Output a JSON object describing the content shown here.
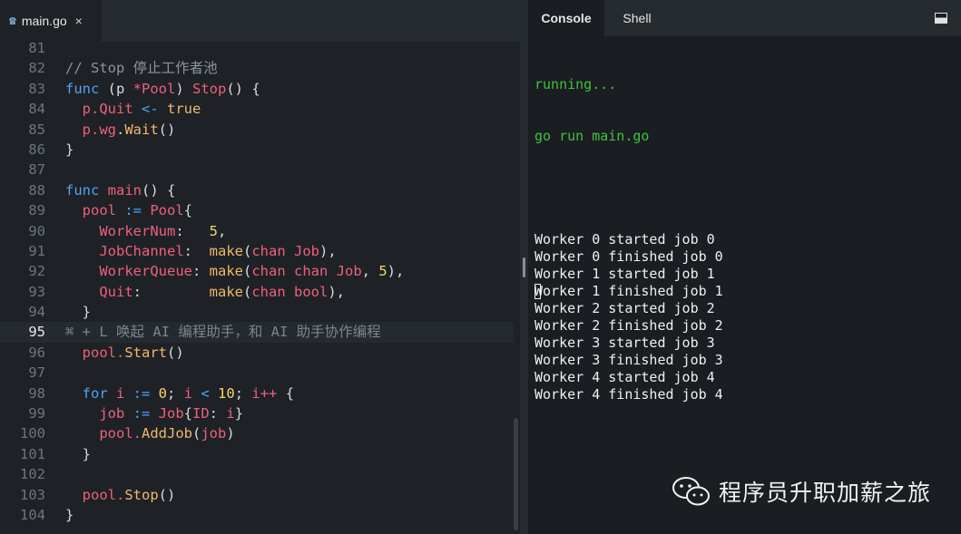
{
  "editor": {
    "tab": {
      "label": "main.go",
      "close": "×",
      "icon": "go-file-icon"
    },
    "current_line": 95,
    "lines": [
      {
        "n": "81",
        "tokens": []
      },
      {
        "n": "82",
        "tokens": [
          {
            "t": "// Stop 停止工作者池",
            "c": "cm"
          }
        ]
      },
      {
        "n": "83",
        "tokens": [
          {
            "t": "func",
            "c": "kw"
          },
          {
            "t": " (",
            "c": "pl"
          },
          {
            "t": "p",
            "c": "pl"
          },
          {
            "t": " *",
            "c": "op"
          },
          {
            "t": "Pool",
            "c": "ty"
          },
          {
            "t": ") ",
            "c": "pl"
          },
          {
            "t": "Stop",
            "c": "ty"
          },
          {
            "t": "() {",
            "c": "pl"
          }
        ]
      },
      {
        "n": "84",
        "tokens": [
          {
            "t": "  p.",
            "c": "op"
          },
          {
            "t": "Quit",
            "c": "ty"
          },
          {
            "t": " <- ",
            "c": "kw"
          },
          {
            "t": "true",
            "c": "bl"
          }
        ]
      },
      {
        "n": "85",
        "tokens": [
          {
            "t": "  p.",
            "c": "op"
          },
          {
            "t": "wg",
            "c": "ty"
          },
          {
            "t": ".",
            "c": "pl"
          },
          {
            "t": "Wait",
            "c": "fn"
          },
          {
            "t": "()",
            "c": "pl"
          }
        ]
      },
      {
        "n": "86",
        "tokens": [
          {
            "t": "}",
            "c": "pl"
          }
        ]
      },
      {
        "n": "87",
        "tokens": []
      },
      {
        "n": "88",
        "tokens": [
          {
            "t": "func",
            "c": "kw"
          },
          {
            "t": " main",
            "c": "ty"
          },
          {
            "t": "() {",
            "c": "pl"
          }
        ]
      },
      {
        "n": "89",
        "tokens": [
          {
            "t": "  pool",
            "c": "op"
          },
          {
            "t": " := ",
            "c": "kw"
          },
          {
            "t": "Pool",
            "c": "ty"
          },
          {
            "t": "{",
            "c": "pl"
          }
        ]
      },
      {
        "n": "90",
        "tokens": [
          {
            "t": "    WorkerNum",
            "c": "op"
          },
          {
            "t": ":   ",
            "c": "pl"
          },
          {
            "t": "5",
            "c": "nm"
          },
          {
            "t": ",",
            "c": "pl"
          }
        ]
      },
      {
        "n": "91",
        "tokens": [
          {
            "t": "    JobChannel",
            "c": "op"
          },
          {
            "t": ":  ",
            "c": "pl"
          },
          {
            "t": "make",
            "c": "fn"
          },
          {
            "t": "(",
            "c": "pl"
          },
          {
            "t": "chan",
            "c": "ty"
          },
          {
            "t": " Job",
            "c": "ty"
          },
          {
            "t": "),",
            "c": "pl"
          }
        ]
      },
      {
        "n": "92",
        "tokens": [
          {
            "t": "    WorkerQueue",
            "c": "op"
          },
          {
            "t": ": ",
            "c": "pl"
          },
          {
            "t": "make",
            "c": "fn"
          },
          {
            "t": "(",
            "c": "pl"
          },
          {
            "t": "chan chan",
            "c": "ty"
          },
          {
            "t": " Job",
            "c": "ty"
          },
          {
            "t": ", ",
            "c": "pl"
          },
          {
            "t": "5",
            "c": "nm"
          },
          {
            "t": "),",
            "c": "pl"
          }
        ]
      },
      {
        "n": "93",
        "tokens": [
          {
            "t": "    Quit",
            "c": "op"
          },
          {
            "t": ":        ",
            "c": "pl"
          },
          {
            "t": "make",
            "c": "fn"
          },
          {
            "t": "(",
            "c": "pl"
          },
          {
            "t": "chan",
            "c": "ty"
          },
          {
            "t": " bool",
            "c": "ty"
          },
          {
            "t": "),",
            "c": "pl"
          }
        ]
      },
      {
        "n": "94",
        "tokens": [
          {
            "t": "  }",
            "c": "pl"
          }
        ]
      },
      {
        "n": "95",
        "tokens": [
          {
            "t": "⌘ + L 唤起 AI 编程助手，和 AI 助手协作编程",
            "c": "hint"
          }
        ]
      },
      {
        "n": "96",
        "tokens": [
          {
            "t": "  pool.",
            "c": "op"
          },
          {
            "t": "Start",
            "c": "fn"
          },
          {
            "t": "()",
            "c": "pl"
          }
        ]
      },
      {
        "n": "97",
        "tokens": []
      },
      {
        "n": "98",
        "tokens": [
          {
            "t": "  for",
            "c": "kw"
          },
          {
            "t": " i",
            "c": "op"
          },
          {
            "t": " := ",
            "c": "kw"
          },
          {
            "t": "0",
            "c": "nm"
          },
          {
            "t": "; ",
            "c": "pl"
          },
          {
            "t": "i",
            "c": "op"
          },
          {
            "t": " < ",
            "c": "kw"
          },
          {
            "t": "10",
            "c": "nm"
          },
          {
            "t": "; ",
            "c": "pl"
          },
          {
            "t": "i++",
            "c": "op"
          },
          {
            "t": " {",
            "c": "pl"
          }
        ]
      },
      {
        "n": "99",
        "tokens": [
          {
            "t": "    job",
            "c": "op"
          },
          {
            "t": " := ",
            "c": "kw"
          },
          {
            "t": "Job",
            "c": "ty"
          },
          {
            "t": "{",
            "c": "pl"
          },
          {
            "t": "ID",
            "c": "op"
          },
          {
            "t": ": ",
            "c": "pl"
          },
          {
            "t": "i",
            "c": "op"
          },
          {
            "t": "}",
            "c": "pl"
          }
        ]
      },
      {
        "n": "100",
        "tokens": [
          {
            "t": "    pool.",
            "c": "op"
          },
          {
            "t": "AddJob",
            "c": "fn"
          },
          {
            "t": "(",
            "c": "pl"
          },
          {
            "t": "job",
            "c": "op"
          },
          {
            "t": ")",
            "c": "pl"
          }
        ]
      },
      {
        "n": "101",
        "tokens": [
          {
            "t": "  }",
            "c": "pl"
          }
        ]
      },
      {
        "n": "102",
        "tokens": []
      },
      {
        "n": "103",
        "tokens": [
          {
            "t": "  pool.",
            "c": "op"
          },
          {
            "t": "Stop",
            "c": "fn"
          },
          {
            "t": "()",
            "c": "pl"
          }
        ]
      },
      {
        "n": "104",
        "tokens": [
          {
            "t": "}",
            "c": "pl"
          }
        ]
      }
    ]
  },
  "console": {
    "tabs": [
      {
        "label": "Console"
      },
      {
        "label": "Shell"
      }
    ],
    "maximize_icon": "maximize-icon",
    "status_lines": [
      "running...",
      "go run main.go"
    ],
    "output_lines": [
      "Worker 0 started job 0",
      "Worker 0 finished job 0",
      "Worker 1 started job 1",
      "Worker 1 finished job 1",
      "Worker 2 started job 2",
      "Worker 2 finished job 2",
      "Worker 3 started job 3",
      "Worker 3 finished job 3",
      "Worker 4 started job 4",
      "Worker 4 finished job 4"
    ]
  },
  "watermark": {
    "text": "程序员升职加薪之旅",
    "icon": "wechat-icon"
  }
}
